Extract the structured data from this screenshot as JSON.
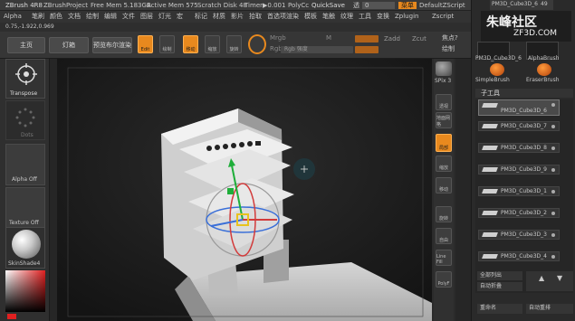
{
  "titlebar": {
    "app": "ZBrush 4R8",
    "project": "ZBrushProject",
    "free_mem": "Free Mem 5.183GB",
    "active_mem": "Active Mem 575",
    "scratch": "Scratch Disk 48",
    "timer": "Timer▶0.001",
    "poly": "PolyCc",
    "quicksave": "QuickSave",
    "opacity_label": "透",
    "opacity_value": "0",
    "menus_label": "菜单",
    "zscript": "DefaultZScript"
  },
  "menus": [
    "Alpha",
    "笔刷",
    "颜色",
    "文档",
    "绘制",
    "编辑",
    "文件",
    "图层",
    "灯光",
    "宏",
    "标记",
    "材质",
    "影片",
    "拾取",
    "首选项",
    "渲染",
    "模板",
    "笔触",
    "纹理",
    "工具",
    "变换",
    "Zplugin",
    "Zscript"
  ],
  "coords": "0.75,-1.922,0.969",
  "toolbar": {
    "home": "主页",
    "lightbox": "灯箱",
    "preview": "预览布尔渲染",
    "edit": "Edit",
    "draw": "绘制",
    "move": "移动",
    "scale": "缩放",
    "rotate": "旋转",
    "mrgb": "Mrgb",
    "rgb": "Rgb",
    "m": "M",
    "rgb_strength": "Rgb 强度",
    "zadd": "Zadd",
    "zsub": "Zsub",
    "zcut": "Zcut",
    "focal": "焦点?",
    "draw_size": "绘制"
  },
  "left_shelf": {
    "transpose": "Transpose",
    "dots": "Dots",
    "alpha": "Alpha Off",
    "texture": "Texture Off",
    "material": "SkinShade4"
  },
  "right_shelf": {
    "spix": "SPix 3",
    "items": [
      "透视",
      "地面网格",
      "局部",
      "缩放",
      "移动",
      "旋转",
      "自由",
      "Line Fill",
      "PolyF"
    ]
  },
  "right_panel": {
    "top_thumb": "PM3D_Cube3D_6",
    "top_count": "49",
    "brushes": [
      "PM3D_Cube3D_6",
      "AlphaBrush",
      "SimpleBrush",
      "EraserBrush"
    ],
    "subtool_header": "子工具",
    "subtools": [
      "PM3D_Cube3D_6",
      "PM3D_Cube3D_7",
      "PM3D_Cube3D_8",
      "PM3D_Cube3D_9",
      "PM3D_Cube3D_1",
      "PM3D_Cube3D_2",
      "PM3D_Cube3D_3",
      "PM3D_Cube3D_4"
    ],
    "list_all": "全部列出",
    "auto_collapse": "自动折叠",
    "rename": "重命名",
    "auto_reorder": "自动重排"
  },
  "watermark": {
    "cn": "朱峰社区",
    "en": "ZF3D.COM"
  },
  "colors": {
    "accent": "#e8891e",
    "panel": "#2a2a2a",
    "viewport": "#1f1f1f"
  }
}
